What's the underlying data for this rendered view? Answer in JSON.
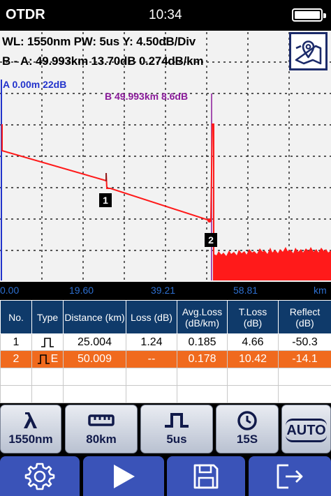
{
  "status_bar": {
    "app_name": "OTDR",
    "time": "10:34",
    "battery_icon": "battery-full-icon"
  },
  "trace_info": {
    "line1": "WL: 1550nm PW: 5us Y: 4.50dB/Div",
    "line2": "B - A: 49.993km  13.70dB  0.274dB/km"
  },
  "markers": {
    "a_label": "A 0.00m 22dB",
    "b_label": "B 49.993km 8.6dB"
  },
  "event_points": [
    {
      "number": "1"
    },
    {
      "number": "2"
    }
  ],
  "x_axis": {
    "ticks": [
      "0.00",
      "19.60",
      "39.21",
      "58.81"
    ],
    "unit": "km"
  },
  "colors": {
    "trace": "#ff1a1a",
    "marker_a": "#2233cc",
    "marker_b": "#8a1a9a",
    "selected_row": "#f06a1e",
    "table_header": "#0f3a6a",
    "button_blue": "#3a53b8"
  },
  "event_table": {
    "headers": [
      "No.",
      "Type",
      "Distance (km)",
      "Loss (dB)",
      "Avg.Loss (dB/km)",
      "T.Loss (dB)",
      "Reflect (dB)"
    ],
    "rows": [
      {
        "no": "1",
        "type_icon": "reflective-pulse-icon",
        "type_text": "",
        "distance": "25.004",
        "loss": "1.24",
        "avg_loss": "0.185",
        "t_loss": "4.66",
        "reflect": "-50.3"
      },
      {
        "no": "2",
        "type_icon": "end-pulse-icon",
        "type_text": "E",
        "distance": "50.009",
        "loss": "--",
        "avg_loss": "0.178",
        "t_loss": "10.42",
        "reflect": "-14.1"
      }
    ]
  },
  "toolbar": {
    "wavelength": "1550nm",
    "range": "80km",
    "pulse_width": "5us",
    "time": "15S",
    "auto": "AUTO"
  }
}
